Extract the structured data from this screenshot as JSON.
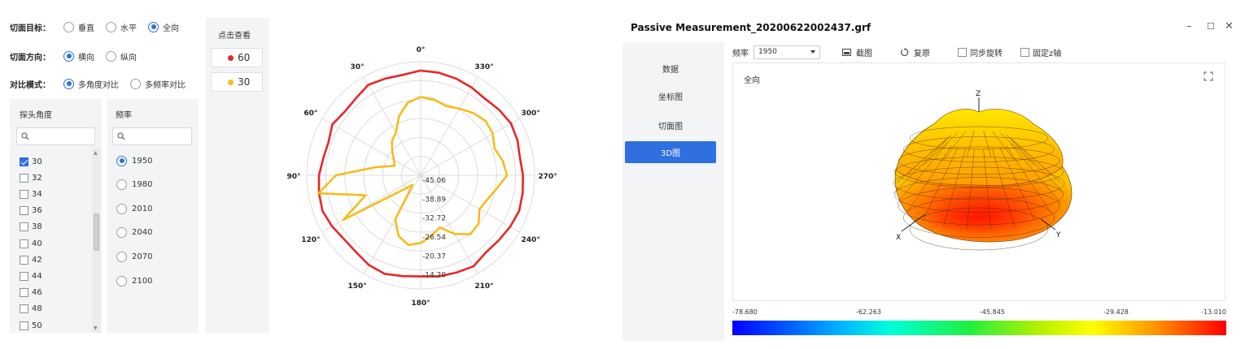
{
  "left": {
    "rows": [
      {
        "label": "切面目标：",
        "options": [
          {
            "text": "垂直",
            "checked": false
          },
          {
            "text": "水平",
            "checked": false
          },
          {
            "text": "全向",
            "checked": true
          }
        ]
      },
      {
        "label": "切面方向：",
        "options": [
          {
            "text": "横向",
            "checked": true
          },
          {
            "text": "纵向",
            "checked": false
          }
        ]
      },
      {
        "label": "对比模式：",
        "options": [
          {
            "text": "多角度对比",
            "checked": true
          },
          {
            "text": "多频率对比",
            "checked": false
          }
        ]
      }
    ],
    "probe_header": "探头角度",
    "freq_header": "频率",
    "probe_items": [
      {
        "label": "30",
        "checked": true
      },
      {
        "label": "32",
        "checked": false
      },
      {
        "label": "34",
        "checked": false
      },
      {
        "label": "36",
        "checked": false
      },
      {
        "label": "38",
        "checked": false
      },
      {
        "label": "40",
        "checked": false
      },
      {
        "label": "42",
        "checked": false
      },
      {
        "label": "44",
        "checked": false
      },
      {
        "label": "46",
        "checked": false
      },
      {
        "label": "48",
        "checked": false
      },
      {
        "label": "50",
        "checked": false
      }
    ],
    "freq_items": [
      {
        "label": "1950",
        "checked": true
      },
      {
        "label": "1980",
        "checked": false
      },
      {
        "label": "2010",
        "checked": false
      },
      {
        "label": "2040",
        "checked": false
      },
      {
        "label": "2070",
        "checked": false
      },
      {
        "label": "2100",
        "checked": false
      }
    ],
    "legend_header": "点击查看",
    "legend": [
      {
        "label": "60",
        "color": "#e8262a"
      },
      {
        "label": "30",
        "color": "#f5bc1c"
      }
    ]
  },
  "chart_data": {
    "type": "polar-line",
    "angle_labels": [
      "0°",
      "30°",
      "60°",
      "90°",
      "120°",
      "150°",
      "180°",
      "210°",
      "240°",
      "270°",
      "300°",
      "330°"
    ],
    "radial_ticks": [
      "-45.06",
      "-38.89",
      "-32.72",
      "-26.54",
      "-20.37",
      "-14.20"
    ],
    "rmin": -45.06,
    "rmax": -8.03,
    "series": [
      {
        "name": "60",
        "color": "#e8262a",
        "r": [
          -10.9,
          -11.8,
          -11.5,
          -11.0,
          -12.3,
          -12.8,
          -11.9,
          -13.2,
          -12.9,
          -12.0,
          -11.5,
          -11.1,
          -11.8,
          -12.6,
          -12.4,
          -11.3,
          -10.9,
          -11.7,
          -12.1,
          -11.6,
          -11.3,
          -10.8,
          -12.2,
          -12.0,
          -11.5,
          -11.0,
          -11.4,
          -11.8,
          -12.3,
          -11.6,
          -11.2,
          -11.8,
          -12.5,
          -12.0,
          -11.5,
          -11.1
        ]
      },
      {
        "name": "30",
        "color": "#f5bc1c",
        "r": [
          -19.5,
          -21.0,
          -24.5,
          -29.0,
          -30.5,
          -33.0,
          -35.0,
          -36.0,
          -30.0,
          -17.5,
          -11.3,
          -26.0,
          -16.0,
          -38.0,
          -41.0,
          -28.5,
          -24.0,
          -22.0,
          -23.0,
          -25.0,
          -27.0,
          -23.0,
          -20.0,
          -20.5,
          -23.0,
          -22.0,
          -20.0,
          -17.0,
          -18.0,
          -19.5,
          -18.0,
          -17.5,
          -18.5,
          -20.0,
          -21.0,
          -20.0
        ]
      }
    ]
  },
  "right": {
    "title": "Passive Measurement_20200622002437.grf",
    "nav": [
      {
        "label": "数据",
        "active": false
      },
      {
        "label": "坐标图",
        "active": false
      },
      {
        "label": "切面图",
        "active": false
      },
      {
        "label": "3D图",
        "active": true
      }
    ],
    "freq_label": "频率",
    "freq_value": "1950",
    "screenshot_label": "截图",
    "reset_label": "复原",
    "sync_label": "同步旋转",
    "fixz_label": "固定z轴",
    "plot_title": "全向",
    "axis_x": "X",
    "axis_y": "Y",
    "axis_z": "Z",
    "scale": [
      "-78.680",
      "-62.263",
      "-45.845",
      "-29.428",
      "-13.010"
    ]
  }
}
